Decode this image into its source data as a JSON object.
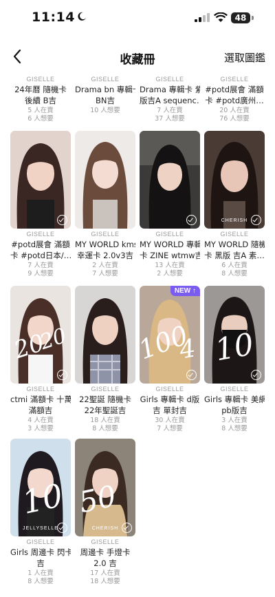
{
  "status": {
    "time": "11:14",
    "battery": "48"
  },
  "nav": {
    "title": "收藏冊",
    "action": "選取圖鑑"
  },
  "row0": [
    {
      "brand": "GISELLE",
      "line1": "24年曆 隨機卡",
      "line2": "後續 B吉",
      "meta1": "5 人在賣",
      "meta2": "6 人想要"
    },
    {
      "brand": "GISELLE",
      "line1": "Drama bn 專輯卡",
      "line2": "BN吉",
      "meta1": "10 人想要",
      "meta2": ""
    },
    {
      "brand": "GISELLE",
      "line1": "Drama 專輯卡 紫",
      "line2": "版吉A sequenc…",
      "meta1": "7 人在賣",
      "meta2": "37 人想要"
    },
    {
      "brand": "GISELLE",
      "line1": "#potd展會 滿額",
      "line2": "卡 #potd廣州…",
      "meta1": "20 人在賣",
      "meta2": "76 人想要"
    }
  ],
  "cards": [
    {
      "brand": "GISELLE",
      "line1": "#potd展會 滿額",
      "line2": "卡 #potd日本/…",
      "meta1": "7 人在賣",
      "meta2": "9 人想要",
      "photo_caption": "",
      "new_label": ""
    },
    {
      "brand": "GISELLE",
      "line1": "MY WORLD kms",
      "line2": "幸運卡 2.0v3吉",
      "meta1": "2 人在賣",
      "meta2": "7 人想要",
      "photo_caption": "",
      "new_label": ""
    },
    {
      "brand": "GISELLE",
      "line1": "MY WORLD 專輯",
      "line2": "卡 ZINE wtmw吉",
      "meta1": "13 人在賣",
      "meta2": "2 人想要",
      "photo_caption": "",
      "new_label": ""
    },
    {
      "brand": "GISELLE",
      "line1": "MY WORLD 隨機",
      "line2": "卡 黑版 吉A 素…",
      "meta1": "6 人在賣",
      "meta2": "8 人想要",
      "photo_caption": "CHERISH",
      "new_label": ""
    },
    {
      "brand": "GISELLE",
      "line1": "ctmi 滿額卡 十萬",
      "line2": "滿額吉",
      "meta1": "4 人在賣",
      "meta2": "3 人想要",
      "photo_caption": "",
      "new_label": ""
    },
    {
      "brand": "GISELLE",
      "line1": "22聖誕 隨機卡",
      "line2": "22年聖誕吉",
      "meta1": "18 人在賣",
      "meta2": "8 人想要",
      "photo_caption": "",
      "new_label": ""
    },
    {
      "brand": "GISELLE",
      "line1": "Girls 專輯卡 d版",
      "line2": "吉 單封吉",
      "meta1": "30 人在賣",
      "meta2": "7 人想要",
      "photo_caption": "",
      "new_label": "NEW ↑"
    },
    {
      "brand": "GISELLE",
      "line1": "Girls 專輯卡 美網",
      "line2": "pb版吉",
      "meta1": "3 人在賣",
      "meta2": "8 人想要",
      "photo_caption": "",
      "new_label": ""
    },
    {
      "brand": "GISELLE",
      "line1": "Girls 周邊卡 閃卡",
      "line2": "吉",
      "meta1": "1 人在賣",
      "meta2": "8 人想要",
      "photo_caption": "JELLYSELLE",
      "new_label": ""
    },
    {
      "brand": "GISELLE",
      "line1": "周邊卡 手燈卡",
      "line2": "2.0 吉",
      "meta1": "17 人在賣",
      "meta2": "18 人想要",
      "photo_caption": "CHERISH",
      "new_label": ""
    }
  ],
  "handwriting": [
    "20",
    "20",
    "100",
    "4",
    "10",
    "10",
    "50"
  ]
}
